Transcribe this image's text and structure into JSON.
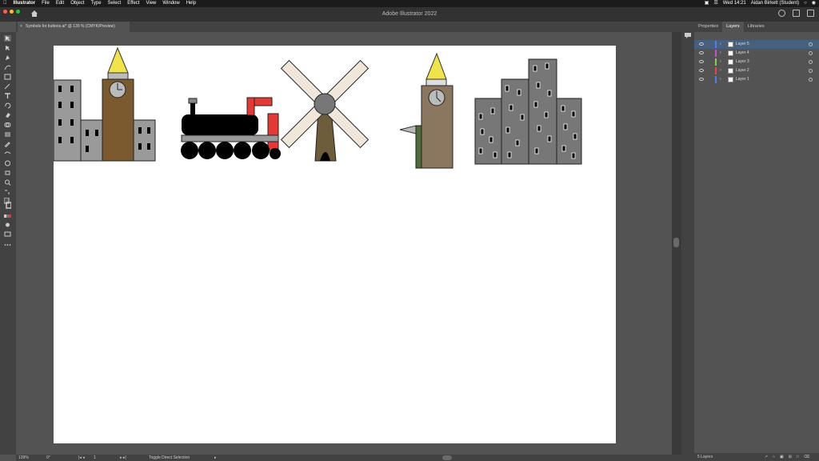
{
  "menubar": {
    "app": "Illustrator",
    "items": [
      "File",
      "Edit",
      "Object",
      "Type",
      "Select",
      "Effect",
      "View",
      "Window",
      "Help"
    ],
    "clock": "Wed 14:21",
    "user": "Aidan Birkett (Student)"
  },
  "window": {
    "title": "Adobe Illustrator 2022"
  },
  "document_tab": {
    "label": "Symbols for buttons.ai* @ 139 % (CMYK/Preview)"
  },
  "panel": {
    "tabs": [
      "Properties",
      "Layers",
      "Libraries"
    ],
    "active_tab": "Layers",
    "layers": [
      {
        "name": "Layer 5",
        "color": "#4f7ef0",
        "selected": true
      },
      {
        "name": "Layer 4",
        "color": "#c84fd0",
        "selected": false
      },
      {
        "name": "Layer 3",
        "color": "#7fd24f",
        "selected": false
      },
      {
        "name": "Layer 2",
        "color": "#e84545",
        "selected": false
      },
      {
        "name": "Layer 1",
        "color": "#4f7ef0",
        "selected": false
      }
    ],
    "footer": "5 Layers"
  },
  "status": {
    "zoom": "139%",
    "rotation": "0°",
    "artboard": "1",
    "hint": "Toggle Direct Selection"
  }
}
